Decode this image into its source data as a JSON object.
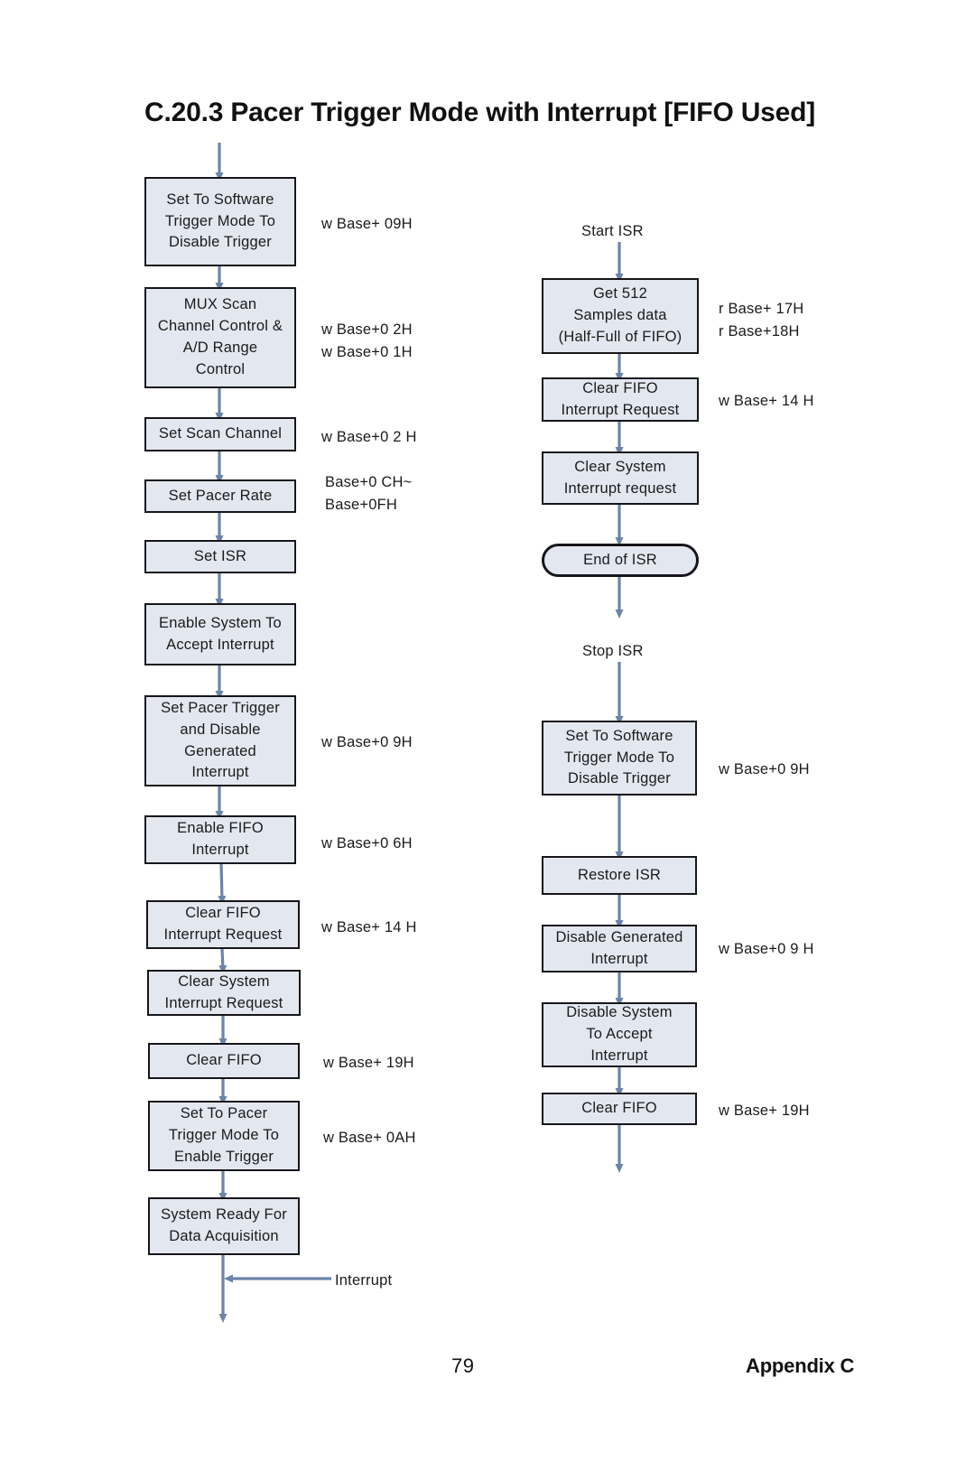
{
  "document": {
    "title": "C.20.3 Pacer Trigger Mode with Interrupt [FIFO Used]",
    "footer": {
      "page_number": "79",
      "section": "Appendix C"
    }
  },
  "colors": {
    "node_fill": "#e3e7ef",
    "node_border": "#16161a",
    "connector": "#6b84a8",
    "text": "#1b1b1b"
  },
  "diagram": {
    "type": "flowchart",
    "columns": [
      {
        "name": "main-initialization-flow",
        "nodes": [
          {
            "id": "set-software-trigger-disable",
            "shape": "process",
            "lines": [
              "Set To Software",
              "Trigger  Mode  To",
              "Disable  Trigger"
            ],
            "annotation": [
              "w Base+ 09H"
            ]
          },
          {
            "id": "mux-scan-channel-control",
            "shape": "process",
            "lines": [
              "MUX  Scan",
              "Channel  Control  &",
              "A/D  Range",
              "Control"
            ],
            "annotation": [
              "w Base+0 2H",
              "w Base+0 1H"
            ]
          },
          {
            "id": "set-scan-channel",
            "shape": "process",
            "lines": [
              "Set  Scan  Channel"
            ],
            "annotation": [
              "w Base+0 2 H"
            ]
          },
          {
            "id": "set-pacer-rate",
            "shape": "process",
            "lines": [
              "Set  Pacer  Rate"
            ],
            "annotation": [
              "Base+0 CH~",
              "Base+0FH"
            ]
          },
          {
            "id": "set-isr",
            "shape": "process",
            "lines": [
              "Set  ISR"
            ],
            "annotation": []
          },
          {
            "id": "enable-system-accept-interrupt",
            "shape": "process",
            "lines": [
              "Enable  System  To",
              "Accept  Interrupt"
            ],
            "annotation": []
          },
          {
            "id": "set-pacer-trigger-disable-generated-interrupt",
            "shape": "process",
            "lines": [
              "Set Pacer Trigger",
              "and Disable",
              "Generated",
              "Interrupt"
            ],
            "annotation": [
              "w Base+0 9H"
            ]
          },
          {
            "id": "enable-fifo-interrupt",
            "shape": "process",
            "lines": [
              "Enable  FIFO",
              "Interrupt"
            ],
            "annotation": [
              "w Base+0 6H"
            ]
          },
          {
            "id": "clear-fifo-interrupt-request",
            "shape": "process",
            "lines": [
              "Clear  FIFO",
              "Interrupt  Request"
            ],
            "annotation": [
              "w Base+ 14 H"
            ]
          },
          {
            "id": "clear-system-interrupt-request",
            "shape": "process",
            "lines": [
              "Clear  System",
              "Interrupt  Request"
            ],
            "annotation": []
          },
          {
            "id": "clear-fifo-main",
            "shape": "process",
            "lines": [
              "Clear  FIFO"
            ],
            "annotation": [
              "w Base+ 19H"
            ]
          },
          {
            "id": "set-pacer-trigger-enable",
            "shape": "process",
            "lines": [
              "Set  To  Pacer",
              "Trigger  Mode  To",
              "Enable  Trigger"
            ],
            "annotation": [
              "w Base+ 0AH"
            ]
          },
          {
            "id": "system-ready",
            "shape": "process",
            "lines": [
              "System  Ready  For",
              "Data  Acquisition"
            ],
            "annotation": []
          }
        ],
        "interrupt_label": "Interrupt"
      },
      {
        "name": "isr-flow",
        "start_label": "Start  ISR",
        "nodes": [
          {
            "id": "get-512-samples",
            "shape": "process",
            "lines": [
              "Get  512",
              "Samples  data",
              "(Half-Full  of FIFO)"
            ],
            "annotation": [
              "r Base+ 17H",
              "r Base+18H"
            ]
          },
          {
            "id": "clear-fifo-interrupt-request-isr",
            "shape": "process",
            "lines": [
              "Clear  FIFO",
              "Interrupt   Request"
            ],
            "annotation": [
              "w Base+ 14 H"
            ]
          },
          {
            "id": "clear-system-interrupt-request-isr",
            "shape": "process",
            "lines": [
              "Clear  System",
              "Interrupt  request"
            ],
            "annotation": []
          },
          {
            "id": "end-of-isr",
            "shape": "terminator",
            "lines": [
              "End  of  ISR"
            ],
            "annotation": []
          }
        ]
      },
      {
        "name": "stop-isr-flow",
        "start_label": "Stop  ISR",
        "nodes": [
          {
            "id": "set-software-trigger-disable-stop",
            "shape": "process",
            "lines": [
              "Set  To  Software",
              "Trigger  Mode  To",
              "Disable  Trigger"
            ],
            "annotation": [
              "w Base+0 9H"
            ]
          },
          {
            "id": "restore-isr",
            "shape": "process",
            "lines": [
              "Restore   ISR"
            ],
            "annotation": []
          },
          {
            "id": "disable-generated-interrupt",
            "shape": "process",
            "lines": [
              "Disable  Generated",
              "Interrupt"
            ],
            "annotation": [
              "w Base+0 9 H"
            ]
          },
          {
            "id": "disable-system-accept-interrupt",
            "shape": "process",
            "lines": [
              "Disable  System",
              "To Accept",
              "Interrupt"
            ],
            "annotation": []
          },
          {
            "id": "clear-fifo-stop",
            "shape": "process",
            "lines": [
              "Clear  FIFO"
            ],
            "annotation": [
              "w Base+ 19H"
            ]
          }
        ]
      }
    ]
  }
}
